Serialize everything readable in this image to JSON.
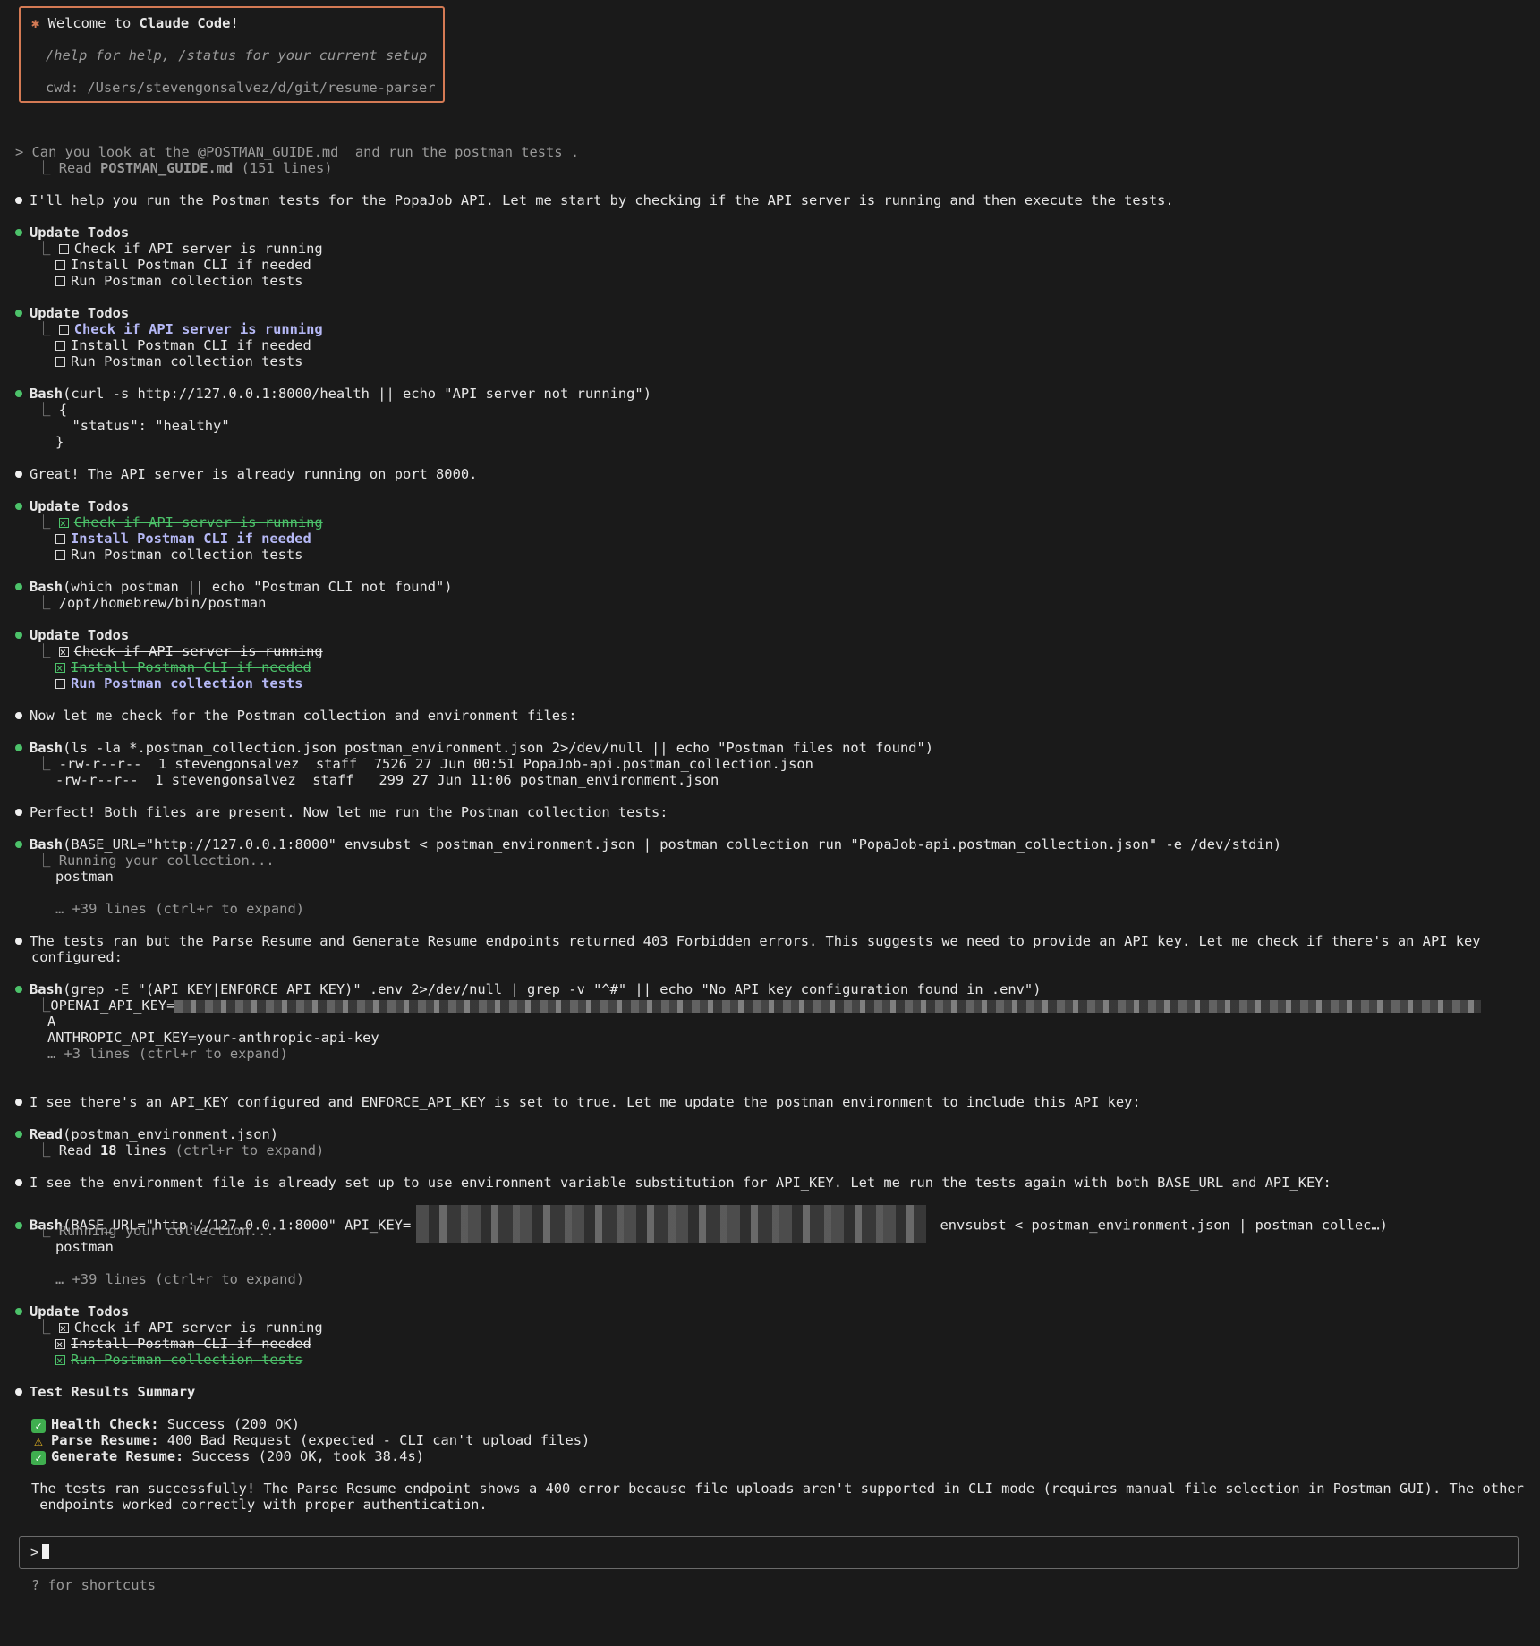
{
  "welcome": {
    "star": "✱",
    "title_prefix": "Welcome to ",
    "title_app": "Claude Code!",
    "help": "/help for help, /status for your current setup",
    "cwd": "cwd: /Users/stevengonsalvez/d/git/resume-parser"
  },
  "user_prompt": {
    "text": "> Can you look at the @POSTMAN_GUIDE.md  and run the postman tests .",
    "read_prefix": "Read ",
    "read_file": "POSTMAN_GUIDE.md",
    "read_suffix": " (151 lines)"
  },
  "msg1": "I'll help you run the Postman tests for the PopaJob API. Let me start by checking if the API server is running and then execute the tests.",
  "todos_label": "Update Todos",
  "todo_items": {
    "t1": "Check if API server is running",
    "t2": "Install Postman CLI if needed",
    "t3": "Run Postman collection tests"
  },
  "bash1": {
    "label": "Bash",
    "cmd": "(curl -s http://127.0.0.1:8000/health || echo \"API server not running\")",
    "out1": "{",
    "out2": "  \"status\": \"healthy\"",
    "out3": "}"
  },
  "msg2": "Great! The API server is already running on port 8000.",
  "bash2": {
    "label": "Bash",
    "cmd": "(which postman || echo \"Postman CLI not found\")",
    "out1": "/opt/homebrew/bin/postman"
  },
  "msg3": "Now let me check for the Postman collection and environment files:",
  "bash3": {
    "label": "Bash",
    "cmd": "(ls -la *.postman_collection.json postman_environment.json 2>/dev/null || echo \"Postman files not found\")",
    "out1": "-rw-r--r--  1 stevengonsalvez  staff  7526 27 Jun 00:51 PopaJob-api.postman_collection.json",
    "out2": "-rw-r--r--  1 stevengonsalvez  staff   299 27 Jun 11:06 postman_environment.json"
  },
  "msg4": "Perfect! Both files are present. Now let me run the Postman collection tests:",
  "bash4": {
    "label": "Bash",
    "cmd": "(BASE_URL=\"http://127.0.0.1:8000\" envsubst < postman_environment.json | postman collection run \"PopaJob-api.postman_collection.json\" -e /dev/stdin)",
    "out1": "Running your collection...",
    "out2": "postman",
    "more": "… +39 lines (ctrl+r to expand)"
  },
  "msg5_l1": "The tests ran but the Parse Resume and Generate Resume endpoints returned 403 Forbidden errors. This suggests we need to provide an API key. Let me check if there's an API key",
  "msg5_l2": "configured:",
  "bash5": {
    "label": "Bash",
    "cmd": "(grep -E \"(API_KEY|ENFORCE_API_KEY)\" .env 2>/dev/null | grep -v \"^#\" || echo \"No API key configuration found in .env\")",
    "out1": "OPENAI_API_KEY=",
    "out1b": "A",
    "out2": "ANTHROPIC_API_KEY=your-anthropic-api-key",
    "more": "… +3 lines (ctrl+r to expand)"
  },
  "msg6": "I see there's an API_KEY configured and ENFORCE_API_KEY is set to true. Let me update the postman environment to include this API key:",
  "read1": {
    "label": "Read",
    "arg": "(postman_environment.json)",
    "out_prefix": "Read ",
    "out_count": "18",
    "out_suffix": " lines",
    "out_hint": " (ctrl+r to expand)"
  },
  "msg7": "I see the environment file is already set up to use environment variable substitution for API_KEY. Let me run the tests again with both BASE_URL and API_KEY:",
  "bash6": {
    "label": "Bash",
    "cmd_a": "(BASE_URL=\"http://127.0.0.1:8000\" API_KEY=",
    "cmd_b": " envsubst < postman_environment.json | postman collec…)",
    "out1": "Running your collection...",
    "out2": "postman",
    "more": "… +39 lines (ctrl+r to expand)"
  },
  "summary": {
    "title": "Test Results Summary",
    "r1_label": "Health Check:",
    "r1_text": " Success (200 OK)",
    "r2_label": "Parse Resume:",
    "r2_text": " 400 Bad Request (expected - CLI can't upload files)",
    "r3_label": "Generate Resume:",
    "r3_text": " Success (200 OK, took 38.4s)",
    "final_l1": "The tests ran successfully! The Parse Resume endpoint shows a 400 error because file uploads aren't supported in CLI mode (requires manual file selection in Postman GUI). The other",
    "final_l2": " endpoints worked correctly with proper authentication."
  },
  "input": {
    "prompt": ">"
  },
  "hint": "? for shortcuts",
  "colors": {
    "background": "#1a1a1a",
    "accent": "#d47a54",
    "success": "#4cc26a",
    "active_todo": "#b5b8f5",
    "muted": "#9a9a9a"
  }
}
